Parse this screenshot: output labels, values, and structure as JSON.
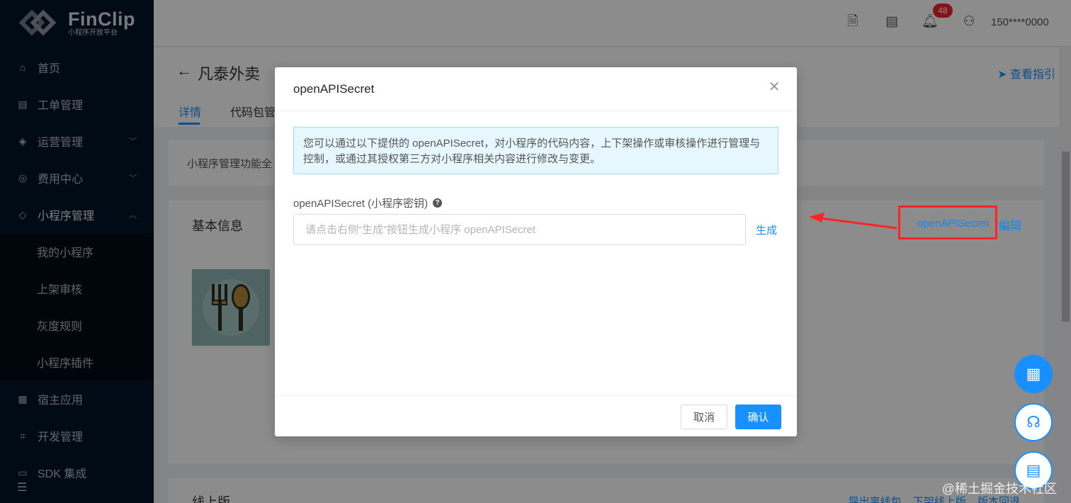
{
  "brand": {
    "name": "FinClip",
    "subtitle": "小程序开放平台"
  },
  "sidebar": {
    "items": [
      {
        "label": "首页",
        "icon": "home-icon"
      },
      {
        "label": "工单管理",
        "icon": "ticket-icon"
      },
      {
        "label": "运营管理",
        "icon": "layers-icon"
      },
      {
        "label": "费用中心",
        "icon": "coin-icon"
      },
      {
        "label": "小程序管理",
        "icon": "miniapp-icon"
      },
      {
        "label": "宿主应用",
        "icon": "grid-icon"
      },
      {
        "label": "开发管理",
        "icon": "code-icon"
      },
      {
        "label": "SDK 集成",
        "icon": "sdk-icon"
      }
    ],
    "sub_items": [
      "我的小程序",
      "上架审核",
      "灰度规则",
      "小程序插件"
    ]
  },
  "header": {
    "notification_count": "48",
    "user": "150****0000"
  },
  "page": {
    "title": "凡泰外卖",
    "guide_link": "查看指引",
    "tabs": [
      "详情",
      "代码包管"
    ],
    "notice": "小程序管理功能全",
    "info_title": "基本信息",
    "action_secret": "openAPISecret",
    "action_edit": "编辑",
    "online_title": "线上版",
    "online_links": [
      "导出离线包",
      "下架线上版",
      "版本回退"
    ]
  },
  "modal": {
    "title": "openAPISecret",
    "alert": "您可以通过以下提供的 openAPISecret，对小程序的代码内容，上下架操作或审核操作进行管理与控制，或通过其授权第三方对小程序相关内容进行修改与变更。",
    "field_label": "openAPISecret (小程序密钥)",
    "input_value": "",
    "input_placeholder": "请点击右侧“生成”按钮生成小程序 openAPISecret",
    "generate": "生成",
    "cancel": "取消",
    "confirm": "确认"
  },
  "watermark": "@稀土掘金技术社区",
  "colors": {
    "primary": "#1890ff",
    "sidebar": "#001529",
    "highlight": "#ff2424",
    "badge": "#f5222d"
  }
}
